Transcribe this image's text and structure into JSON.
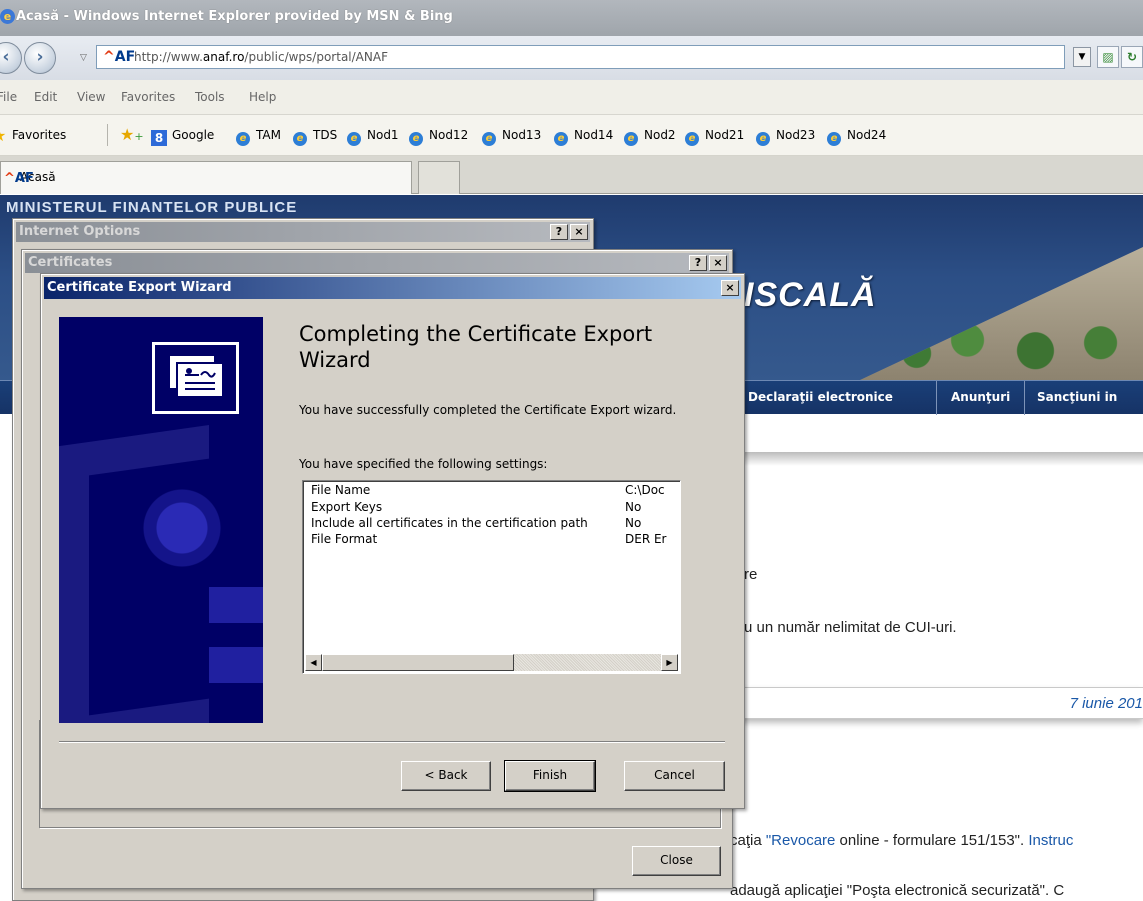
{
  "browser": {
    "title": "Acasă - Windows Internet Explorer provided by MSN & Bing",
    "url_prefix": "http://www.",
    "url_domain": "anaf.ro",
    "url_path": "/public/wps/portal/ANAF",
    "af_logo": "AF",
    "menu": [
      "File",
      "Edit",
      "View",
      "Favorites",
      "Tools",
      "Help"
    ],
    "favorites_label": "Favorites",
    "favorites": [
      "Google",
      "TAM",
      "TDS",
      "Nod1",
      "Nod12",
      "Nod13",
      "Nod14",
      "Nod2",
      "Nod21",
      "Nod23",
      "Nod24"
    ],
    "tab_title": "Acasă"
  },
  "page": {
    "ministry_text": "MINISTERUL FINANTELOR PUBLICE",
    "site_title_partial": "ISCALĂ",
    "nav": [
      "Declaraţii electronice",
      "Anunţuri",
      "Sancţiuni in"
    ],
    "text_fragment_1": "re",
    "text_fragment_2": "u un număr nelimitat de CUI-uri.",
    "date": "7 iunie 201",
    "news_prefix": "caţia ",
    "news_link": "\"Revocare",
    "news_mid": " online - formulare 151/153\". ",
    "news_link2": "Instruc",
    "news_line2": "adaugă aplicaţiei \"Poşta electronică securizată\". C"
  },
  "internet_options": {
    "title": "Internet Options",
    "help_btn": "?",
    "close_btn": "×"
  },
  "certificates": {
    "title": "Certificates",
    "help_btn": "?",
    "close_btn": "×",
    "close_label": "Close"
  },
  "wizard": {
    "title": "Certificate Export Wizard",
    "close_btn": "×",
    "heading": "Completing the Certificate Export Wizard",
    "success_text": "You have successfully completed the Certificate Export wizard.",
    "specified_text": "You have specified the following settings:",
    "settings": [
      {
        "key": "File Name",
        "value": "C:\\Doc"
      },
      {
        "key": "Export Keys",
        "value": "No"
      },
      {
        "key": "Include all certificates in the certification path",
        "value": "No"
      },
      {
        "key": "File Format",
        "value": "DER Er"
      }
    ],
    "back_label": "< Back",
    "finish_label": "Finish",
    "cancel_label": "Cancel"
  }
}
